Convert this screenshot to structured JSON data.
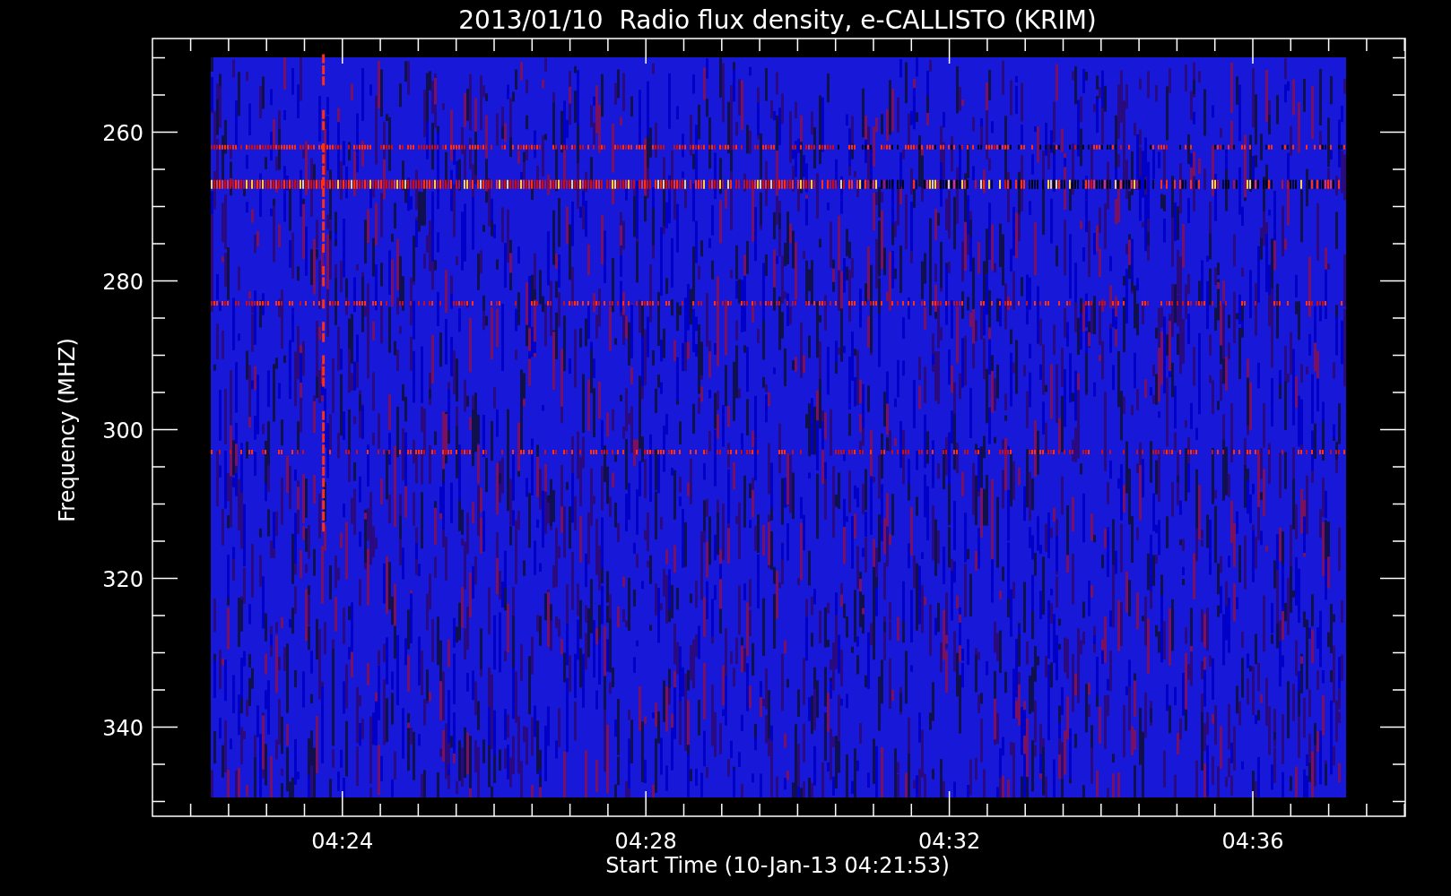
{
  "plot": {
    "title": "2013/01/10  Radio flux density, e-CALLISTO (KRIM)",
    "y_axis": {
      "label": "Frequency (MHZ)",
      "ticks": [
        "260",
        "280",
        "300",
        "320",
        "340"
      ]
    },
    "x_axis": {
      "label": "Start Time (10-Jan-13 04:21:53)",
      "ticks": [
        "04:24",
        "04:28",
        "04:32",
        "04:36"
      ]
    }
  }
}
